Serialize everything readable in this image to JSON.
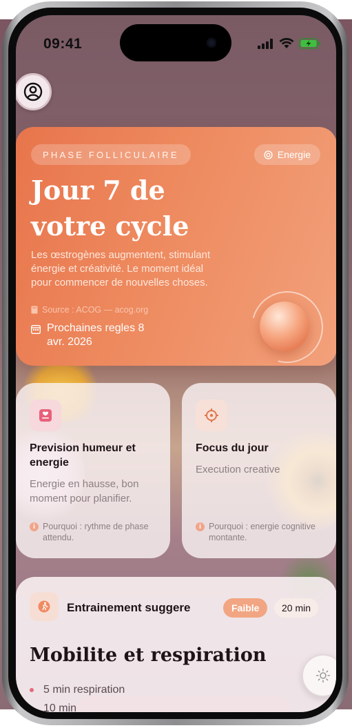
{
  "status_bar": {
    "time": "09:41"
  },
  "hero": {
    "phase": "PHASE FOLLICULAIRE",
    "energy_label": "Energie",
    "title": "Jour 7 de votre cycle",
    "description": "Les œstrogènes augmentent, stimulant énergie et créativité. Le moment idéal pour commencer de nouvelles choses.",
    "source": "Source : ACOG — acog.org",
    "next_period": "Prochaines regles 8 avr. 2026"
  },
  "cards": [
    {
      "title": "Prevision humeur et energie",
      "body": "Energie en hausse, bon moment pour planifier.",
      "note": "Pourquoi : rythme de phase attendu."
    },
    {
      "title": "Focus du jour",
      "body": "Execution creative",
      "note": "Pourquoi : energie cognitive montante."
    }
  ],
  "workout": {
    "label": "Entrainement suggere",
    "intensity": "Faible",
    "duration": "20 min",
    "title": "Mobilite et respiration",
    "items": [
      "5 min respiration",
      "10 min"
    ]
  },
  "colors": {
    "accent": "#ee8a5f",
    "hero_start": "#e8754c",
    "hero_end": "#f2a17b",
    "card_bg": "#f8f0f2",
    "badge_low": "#f2a582",
    "icon_pink": "#e8607a",
    "icon_orange": "#e0784e"
  },
  "icons": {
    "profile": "person-circle-icon",
    "energy": "target-icon",
    "source": "book-icon",
    "calendar": "calendar-icon",
    "mood": "mood-card-icon",
    "focus": "crosshair-icon",
    "info": "info-icon",
    "workout": "runner-icon",
    "theme": "sun-icon"
  }
}
